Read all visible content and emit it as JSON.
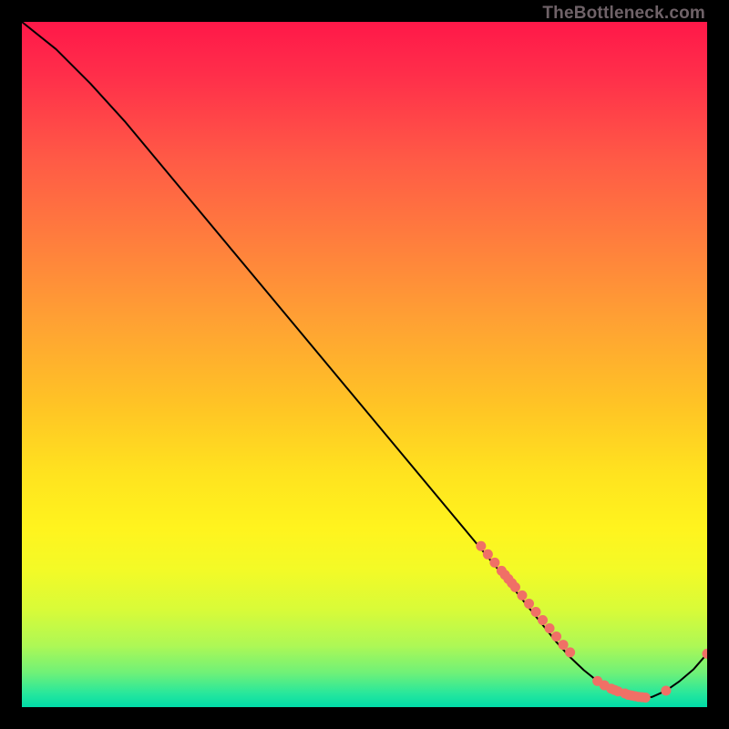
{
  "watermark": "TheBottleneck.com",
  "chart_data": {
    "type": "line",
    "title": "",
    "xlabel": "",
    "ylabel": "",
    "xlim": [
      0,
      100
    ],
    "ylim": [
      0,
      100
    ],
    "grid": false,
    "series": [
      {
        "name": "bottleneck-curve",
        "x": [
          0,
          5,
          10,
          15,
          20,
          25,
          30,
          35,
          40,
          45,
          50,
          55,
          60,
          65,
          70,
          72,
          74,
          76,
          78,
          80,
          82,
          84,
          86,
          88,
          90,
          92,
          94,
          96,
          98,
          100
        ],
        "y": [
          100,
          96,
          91,
          85.5,
          79.5,
          73.5,
          67.5,
          61.5,
          55.5,
          49.5,
          43.5,
          37.5,
          31.5,
          25.5,
          19.5,
          17.0,
          14.5,
          12.0,
          9.5,
          7.3,
          5.4,
          3.8,
          2.5,
          1.6,
          1.2,
          1.5,
          2.4,
          3.8,
          5.5,
          7.8
        ]
      }
    ],
    "markers": {
      "name": "highlight-points",
      "color": "#f07066",
      "x": [
        67,
        68,
        69,
        70,
        70.5,
        71,
        71.5,
        72,
        73,
        74,
        75,
        76,
        77,
        78,
        79,
        80,
        84,
        85,
        86,
        86.5,
        87,
        88,
        88.5,
        89,
        89.5,
        90,
        90.5,
        91,
        94,
        100
      ],
      "y": [
        23.5,
        22.3,
        21.1,
        19.9,
        19.3,
        18.7,
        18.1,
        17.5,
        16.3,
        15.1,
        13.9,
        12.7,
        11.5,
        10.3,
        9.1,
        8.0,
        3.8,
        3.2,
        2.7,
        2.5,
        2.3,
        2.0,
        1.8,
        1.7,
        1.6,
        1.5,
        1.45,
        1.4,
        2.4,
        7.8
      ]
    }
  }
}
